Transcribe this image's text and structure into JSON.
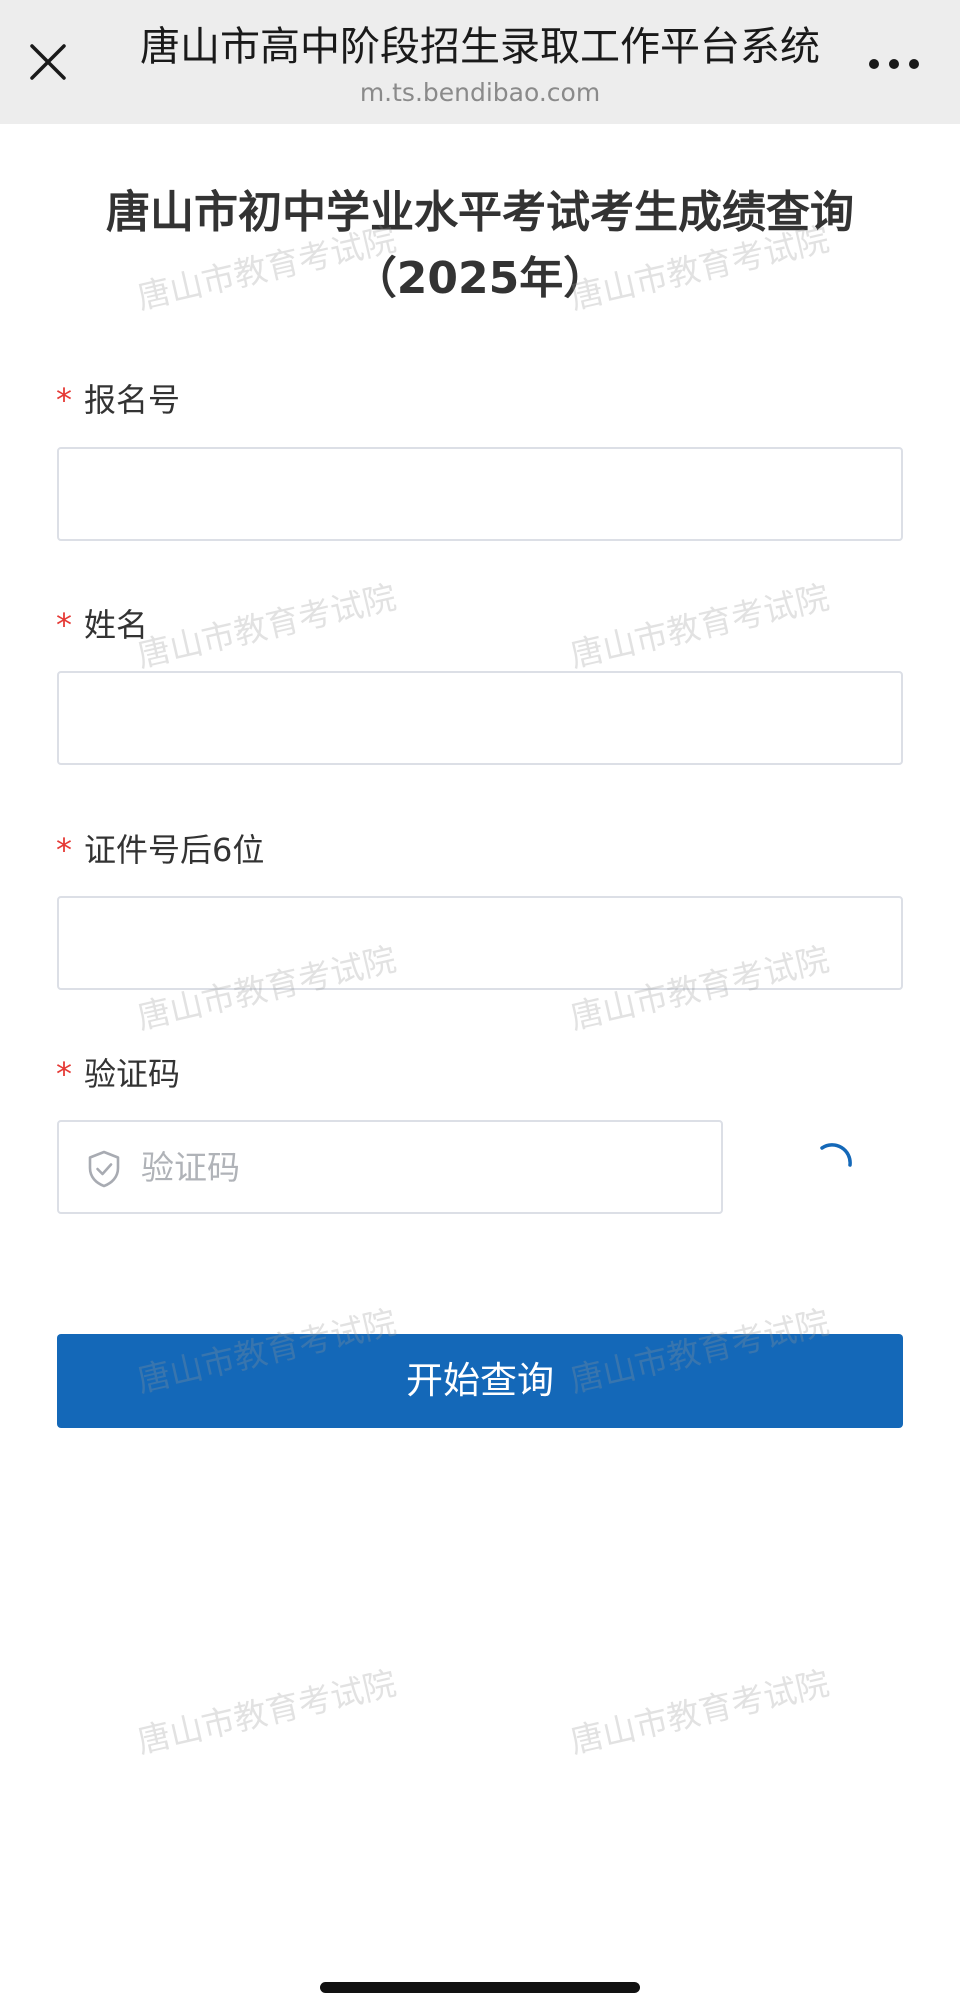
{
  "nav": {
    "title": "唐山市高中阶段招生录取工作平台系统",
    "url": "m.ts.bendibao.com",
    "close_icon": "close-icon",
    "more_icon": "more-icon"
  },
  "page": {
    "title_line1": "唐山市初中学业水平考试考生成绩查询",
    "title_line2": "（2025年）"
  },
  "form": {
    "required_mark": "*",
    "fields": [
      {
        "label": "报名号",
        "value": "",
        "placeholder": ""
      },
      {
        "label": "姓名",
        "value": "",
        "placeholder": ""
      },
      {
        "label": "证件号后6位",
        "value": "",
        "placeholder": ""
      }
    ],
    "captcha": {
      "label": "验证码",
      "placeholder": "验证码",
      "value": "",
      "icon": "shield-check-icon",
      "loading": true
    },
    "submit_label": "开始查询"
  },
  "watermark_text": "唐山市教育考试院",
  "colors": {
    "primary": "#1468b8",
    "required": "#e53935",
    "nav_bg": "#ededed",
    "border": "#dcdfe6"
  }
}
